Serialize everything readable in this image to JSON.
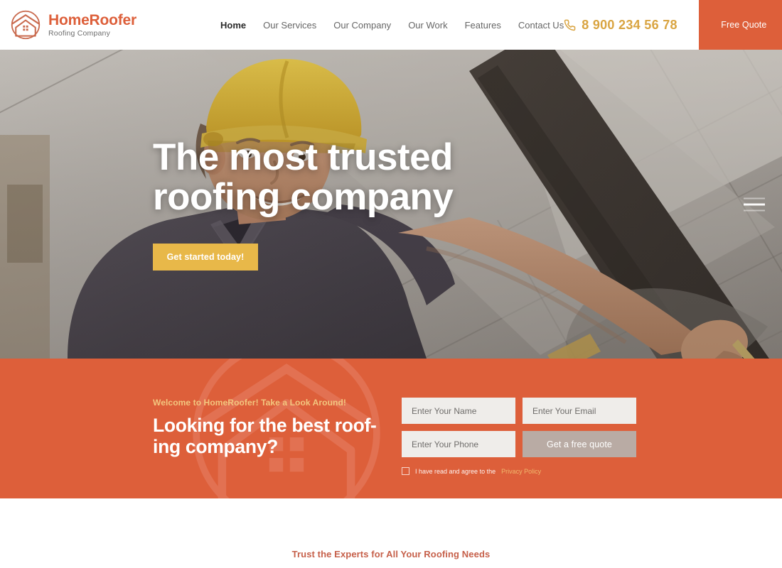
{
  "header": {
    "logo": {
      "icon": "house-circle-logo-icon",
      "title": "HomeRoofer",
      "subtitle": "Roofing Company"
    },
    "nav": [
      {
        "label": "Home",
        "active": true
      },
      {
        "label": "Our Services",
        "active": false
      },
      {
        "label": "Our Company",
        "active": false
      },
      {
        "label": "Our Work",
        "active": false
      },
      {
        "label": "Features",
        "active": false
      },
      {
        "label": "Contact Us",
        "active": false
      }
    ],
    "phone": {
      "icon": "phone-icon",
      "number": "8 900 234 56 78"
    },
    "free_quote_label": "Free Quote"
  },
  "hero": {
    "title_line1": "The most trusted",
    "title_line2": "roofing company",
    "cta_label": "Get started today!",
    "menu_icon": "hamburger-menu-icon",
    "image_alt": "roofer-in-yellow-hard-hat-on-tiled-roof"
  },
  "cta": {
    "eyebrow": "Welcome to HomeRoofer! Take a Look Around!",
    "title_line1": "Looking for the best roof-",
    "title_line2": "ing company?",
    "form": {
      "name_placeholder": "Enter Your Name",
      "email_placeholder": "Enter Your Email",
      "phone_placeholder": "Enter Your Phone",
      "submit_label": "Get a free quote",
      "name_value": "",
      "email_value": "",
      "phone_value": "",
      "agree_text": "I have read and agree to the",
      "agree_link": "Privacy Policy"
    }
  },
  "bottom": {
    "eyebrow": "Trust the Experts for All Your Roofing Needs"
  },
  "colors": {
    "brand_orange": "#dd5f3a",
    "accent_gold": "#e8b849",
    "phone_gold": "#d9a441",
    "field_bg": "#efedea",
    "submit_bg": "#b9aba4"
  }
}
